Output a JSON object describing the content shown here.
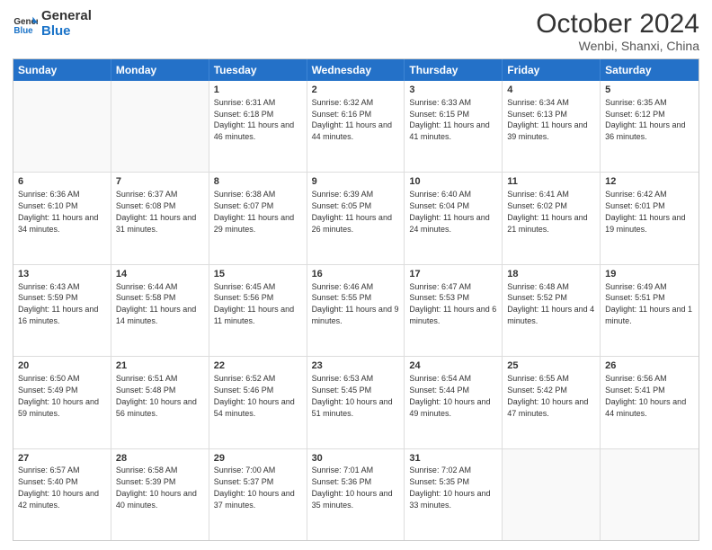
{
  "header": {
    "logo_general": "General",
    "logo_blue": "Blue",
    "month_title": "October 2024",
    "location": "Wenbi, Shanxi, China"
  },
  "days_of_week": [
    "Sunday",
    "Monday",
    "Tuesday",
    "Wednesday",
    "Thursday",
    "Friday",
    "Saturday"
  ],
  "weeks": [
    [
      {
        "day": "",
        "info": ""
      },
      {
        "day": "",
        "info": ""
      },
      {
        "day": "1",
        "sunrise": "Sunrise: 6:31 AM",
        "sunset": "Sunset: 6:18 PM",
        "daylight": "Daylight: 11 hours and 46 minutes."
      },
      {
        "day": "2",
        "sunrise": "Sunrise: 6:32 AM",
        "sunset": "Sunset: 6:16 PM",
        "daylight": "Daylight: 11 hours and 44 minutes."
      },
      {
        "day": "3",
        "sunrise": "Sunrise: 6:33 AM",
        "sunset": "Sunset: 6:15 PM",
        "daylight": "Daylight: 11 hours and 41 minutes."
      },
      {
        "day": "4",
        "sunrise": "Sunrise: 6:34 AM",
        "sunset": "Sunset: 6:13 PM",
        "daylight": "Daylight: 11 hours and 39 minutes."
      },
      {
        "day": "5",
        "sunrise": "Sunrise: 6:35 AM",
        "sunset": "Sunset: 6:12 PM",
        "daylight": "Daylight: 11 hours and 36 minutes."
      }
    ],
    [
      {
        "day": "6",
        "sunrise": "Sunrise: 6:36 AM",
        "sunset": "Sunset: 6:10 PM",
        "daylight": "Daylight: 11 hours and 34 minutes."
      },
      {
        "day": "7",
        "sunrise": "Sunrise: 6:37 AM",
        "sunset": "Sunset: 6:08 PM",
        "daylight": "Daylight: 11 hours and 31 minutes."
      },
      {
        "day": "8",
        "sunrise": "Sunrise: 6:38 AM",
        "sunset": "Sunset: 6:07 PM",
        "daylight": "Daylight: 11 hours and 29 minutes."
      },
      {
        "day": "9",
        "sunrise": "Sunrise: 6:39 AM",
        "sunset": "Sunset: 6:05 PM",
        "daylight": "Daylight: 11 hours and 26 minutes."
      },
      {
        "day": "10",
        "sunrise": "Sunrise: 6:40 AM",
        "sunset": "Sunset: 6:04 PM",
        "daylight": "Daylight: 11 hours and 24 minutes."
      },
      {
        "day": "11",
        "sunrise": "Sunrise: 6:41 AM",
        "sunset": "Sunset: 6:02 PM",
        "daylight": "Daylight: 11 hours and 21 minutes."
      },
      {
        "day": "12",
        "sunrise": "Sunrise: 6:42 AM",
        "sunset": "Sunset: 6:01 PM",
        "daylight": "Daylight: 11 hours and 19 minutes."
      }
    ],
    [
      {
        "day": "13",
        "sunrise": "Sunrise: 6:43 AM",
        "sunset": "Sunset: 5:59 PM",
        "daylight": "Daylight: 11 hours and 16 minutes."
      },
      {
        "day": "14",
        "sunrise": "Sunrise: 6:44 AM",
        "sunset": "Sunset: 5:58 PM",
        "daylight": "Daylight: 11 hours and 14 minutes."
      },
      {
        "day": "15",
        "sunrise": "Sunrise: 6:45 AM",
        "sunset": "Sunset: 5:56 PM",
        "daylight": "Daylight: 11 hours and 11 minutes."
      },
      {
        "day": "16",
        "sunrise": "Sunrise: 6:46 AM",
        "sunset": "Sunset: 5:55 PM",
        "daylight": "Daylight: 11 hours and 9 minutes."
      },
      {
        "day": "17",
        "sunrise": "Sunrise: 6:47 AM",
        "sunset": "Sunset: 5:53 PM",
        "daylight": "Daylight: 11 hours and 6 minutes."
      },
      {
        "day": "18",
        "sunrise": "Sunrise: 6:48 AM",
        "sunset": "Sunset: 5:52 PM",
        "daylight": "Daylight: 11 hours and 4 minutes."
      },
      {
        "day": "19",
        "sunrise": "Sunrise: 6:49 AM",
        "sunset": "Sunset: 5:51 PM",
        "daylight": "Daylight: 11 hours and 1 minute."
      }
    ],
    [
      {
        "day": "20",
        "sunrise": "Sunrise: 6:50 AM",
        "sunset": "Sunset: 5:49 PM",
        "daylight": "Daylight: 10 hours and 59 minutes."
      },
      {
        "day": "21",
        "sunrise": "Sunrise: 6:51 AM",
        "sunset": "Sunset: 5:48 PM",
        "daylight": "Daylight: 10 hours and 56 minutes."
      },
      {
        "day": "22",
        "sunrise": "Sunrise: 6:52 AM",
        "sunset": "Sunset: 5:46 PM",
        "daylight": "Daylight: 10 hours and 54 minutes."
      },
      {
        "day": "23",
        "sunrise": "Sunrise: 6:53 AM",
        "sunset": "Sunset: 5:45 PM",
        "daylight": "Daylight: 10 hours and 51 minutes."
      },
      {
        "day": "24",
        "sunrise": "Sunrise: 6:54 AM",
        "sunset": "Sunset: 5:44 PM",
        "daylight": "Daylight: 10 hours and 49 minutes."
      },
      {
        "day": "25",
        "sunrise": "Sunrise: 6:55 AM",
        "sunset": "Sunset: 5:42 PM",
        "daylight": "Daylight: 10 hours and 47 minutes."
      },
      {
        "day": "26",
        "sunrise": "Sunrise: 6:56 AM",
        "sunset": "Sunset: 5:41 PM",
        "daylight": "Daylight: 10 hours and 44 minutes."
      }
    ],
    [
      {
        "day": "27",
        "sunrise": "Sunrise: 6:57 AM",
        "sunset": "Sunset: 5:40 PM",
        "daylight": "Daylight: 10 hours and 42 minutes."
      },
      {
        "day": "28",
        "sunrise": "Sunrise: 6:58 AM",
        "sunset": "Sunset: 5:39 PM",
        "daylight": "Daylight: 10 hours and 40 minutes."
      },
      {
        "day": "29",
        "sunrise": "Sunrise: 7:00 AM",
        "sunset": "Sunset: 5:37 PM",
        "daylight": "Daylight: 10 hours and 37 minutes."
      },
      {
        "day": "30",
        "sunrise": "Sunrise: 7:01 AM",
        "sunset": "Sunset: 5:36 PM",
        "daylight": "Daylight: 10 hours and 35 minutes."
      },
      {
        "day": "31",
        "sunrise": "Sunrise: 7:02 AM",
        "sunset": "Sunset: 5:35 PM",
        "daylight": "Daylight: 10 hours and 33 minutes."
      },
      {
        "day": "",
        "info": ""
      },
      {
        "day": "",
        "info": ""
      }
    ]
  ]
}
